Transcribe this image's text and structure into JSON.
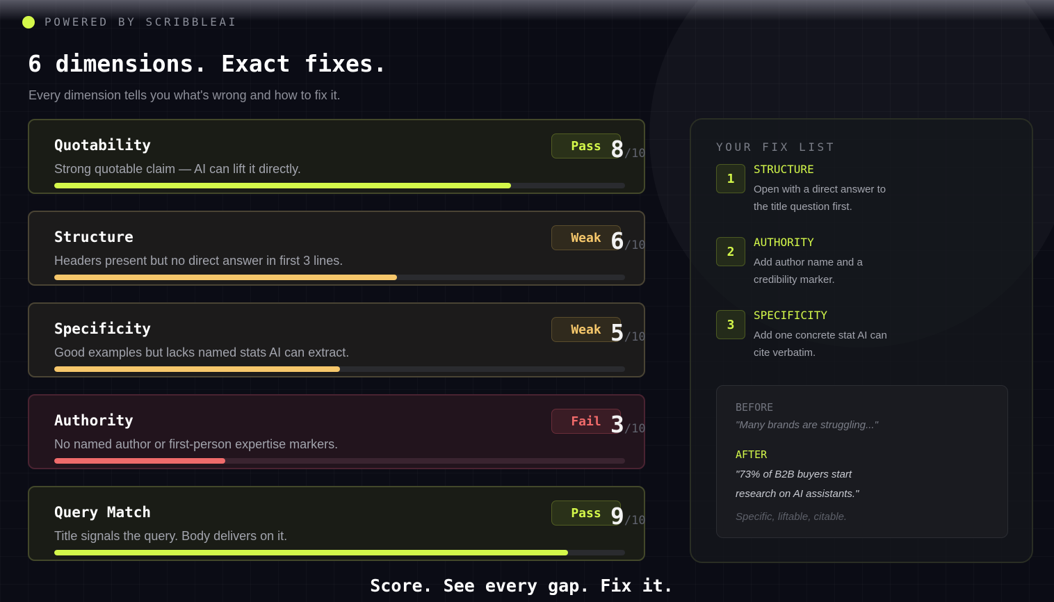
{
  "header": {
    "powered_by": "POWERED BY SCRIBBLEAI",
    "title": "6 dimensions. Exact fixes.",
    "subtitle": "Every dimension tells you what's wrong and how to fix it."
  },
  "dimensions": [
    {
      "name": "Quotability",
      "description": "Strong quotable claim — AI can lift it directly.",
      "status": "Pass",
      "score": "8",
      "max": "/10",
      "fraction": 0.8
    },
    {
      "name": "Structure",
      "description": "Headers present but no direct answer in first 3 lines.",
      "status": "Weak",
      "score": "6",
      "max": "/10",
      "fraction": 0.6
    },
    {
      "name": "Specificity",
      "description": "Good examples but lacks named stats AI can extract.",
      "status": "Weak",
      "score": "5",
      "max": "/10",
      "fraction": 0.5
    },
    {
      "name": "Authority",
      "description": "No named author or first-person expertise markers.",
      "status": "Fail",
      "score": "3",
      "max": "/10",
      "fraction": 0.3
    },
    {
      "name": "Query Match",
      "description": "Title signals the query. Body delivers on it.",
      "status": "Pass",
      "score": "9",
      "max": "/10",
      "fraction": 0.9
    }
  ],
  "fix_list": {
    "heading": "YOUR FIX LIST",
    "items": [
      {
        "num": "1",
        "title": "STRUCTURE",
        "text": "Open with a direct answer to the title question first."
      },
      {
        "num": "2",
        "title": "AUTHORITY",
        "text": "Add author name and a credibility marker."
      },
      {
        "num": "3",
        "title": "SPECIFICITY",
        "text": "Add one concrete stat AI can cite verbatim."
      }
    ],
    "before_label": "BEFORE",
    "before_quote": "\"Many brands are struggling...\"",
    "after_label": "AFTER",
    "after_quote": "\"73% of B2B buyers start research on AI assistants.\"",
    "note": "Specific, liftable, citable."
  },
  "tagline": "Score. See every gap. Fix it.",
  "colors": {
    "accent": "#d4f84a",
    "weak": "#f6c76b",
    "fail": "#ef6b6b",
    "background": "#0b0c15"
  }
}
